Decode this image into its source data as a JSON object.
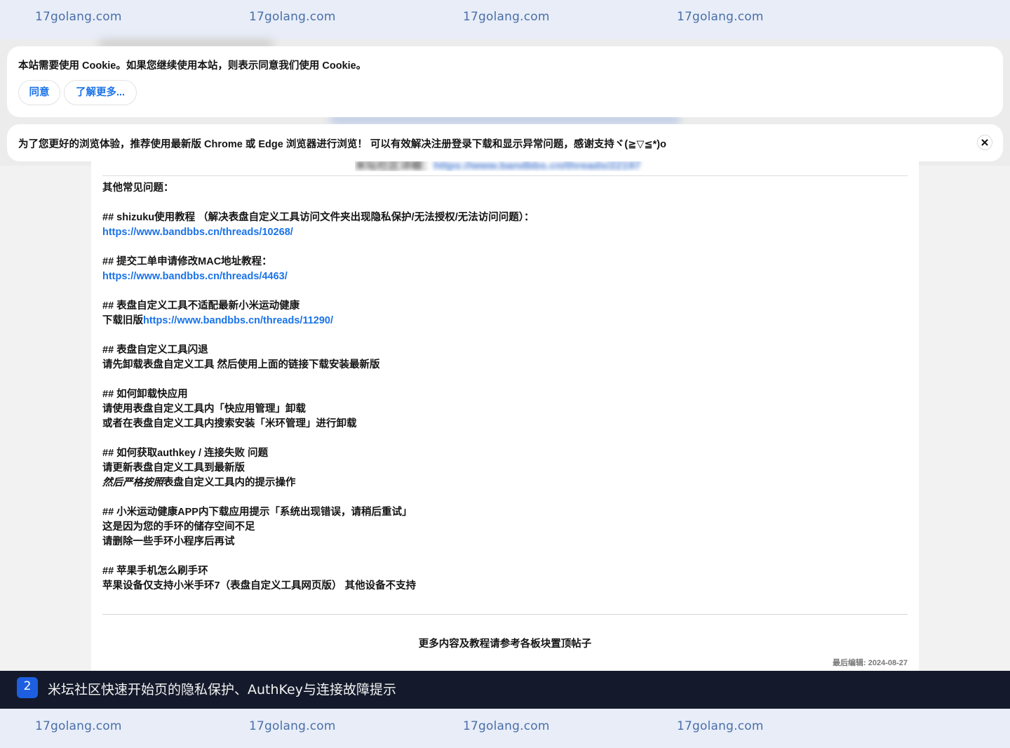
{
  "watermark": {
    "text": "17golang.com"
  },
  "cookie_banner": {
    "message": "本站需要使用 Cookie。如果您继续使用本站，则表示同意我们使用 Cookie。",
    "agree_label": "同意",
    "learn_more_label": "了解更多..."
  },
  "browser_banner": {
    "message": "为了您更好的浏览体验，推荐使用最新版 Chrome 或 Edge 浏览器进行浏览！ 可以有效解决注册登录下载和显示异常问题，感谢支持ヾ(≧▽≦*)o",
    "close_icon": "close-icon"
  },
  "post": {
    "blurred_label": "米坛社区详细：",
    "blurred_link": "https://www.bandbbs.cn/threads/22197",
    "faq_heading": "其他常见问题：",
    "faq": [
      {
        "title": "## shizuku使用教程 （解决表盘自定义工具访问文件夹出现隐私保护/无法授权/无法访问问题）：",
        "link": "https://www.bandbbs.cn/threads/10268/"
      },
      {
        "title": "## 提交工单申请修改MAC地址教程：",
        "link": "https://www.bandbbs.cn/threads/4463/"
      },
      {
        "title": "## 表盘自定义工具不适配最新小米运动健康",
        "prefix": "下载旧版",
        "link": "https://www.bandbbs.cn/threads/11290/"
      },
      {
        "title": "## 表盘自定义工具闪退",
        "line1": "请先卸载表盘自定义工具 然后使用上面的链接下载安装最新版"
      },
      {
        "title": "## 如何卸载快应用",
        "line1": "请使用表盘自定义工具内「快应用管理」卸载",
        "line2": "或者在表盘自定义工具内搜索安装「米环管理」进行卸载"
      },
      {
        "title": "## 如何获取authkey / 连接失败 问题",
        "line1": "请更新表盘自定义工具到最新版",
        "line2_italic": "然后严格按照",
        "line2_rest": "表盘自定义工具内的提示操作"
      },
      {
        "title": "## 小米运动健康APP内下载应用提示「系统出现错误，请稍后重试」",
        "line1": "这是因为您的手环的储存空间不足",
        "line2": "请删除一些手环小程序后再试"
      },
      {
        "title": "## 苹果手机怎么刷手环",
        "line1": "苹果设备仅支持小米手环7（表盘自定义工具网页版） 其他设备不支持"
      }
    ],
    "more_note": "更多内容及教程请参考各板块置顶帖子",
    "last_edited": "最后编辑: 2024-08-27"
  },
  "caption": {
    "number": "2",
    "text": "米坛社区快速开始页的隐私保护、AuthKey与连接故障提示"
  },
  "colors": {
    "link": "#1a73e8",
    "caption_bg": "#141a2b",
    "badge_bg": "#1d5fe0",
    "watermark": "#4a6fa8"
  }
}
